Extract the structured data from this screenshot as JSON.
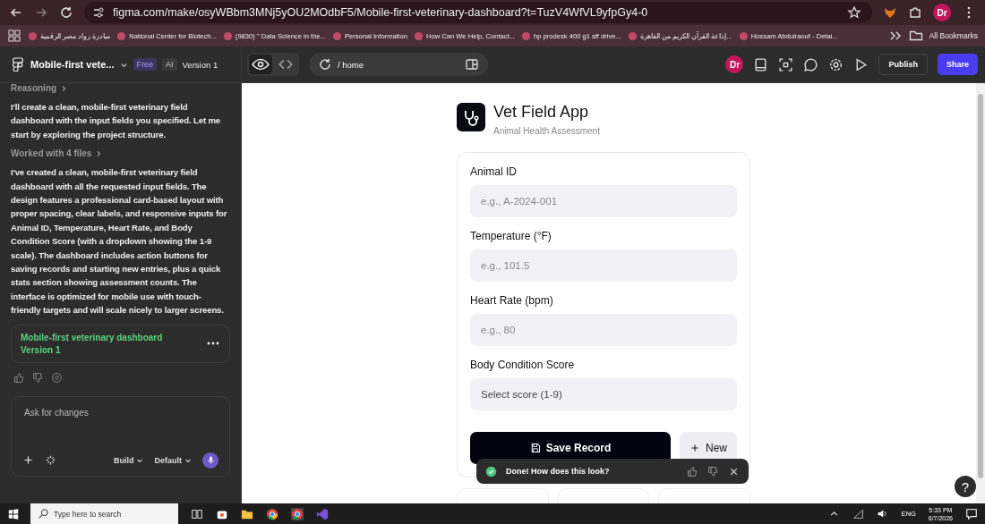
{
  "browser": {
    "url": "figma.com/make/osyWBbm3MNj5yOU2MOdbF5/Mobile-first-veterinary-dashboard?t=TuzV4WfVL9yfpGy4-0",
    "profile": "Dr",
    "bookmarks": [
      {
        "label": "مبادرة رواد مصر الرقمية"
      },
      {
        "label": "National Center for Biotech..."
      },
      {
        "label": "(9830) \" Data Science in the..."
      },
      {
        "label": "Personal Information"
      },
      {
        "label": "How Can We Help, Contact..."
      },
      {
        "label": "hp prodesk 400 g1 sff drive..."
      },
      {
        "label": "إذاعة القرآن الكريم من القاهرة..."
      },
      {
        "label": "Hossam Abdulraouf - Detai..."
      }
    ],
    "all_bookmarks": "All Bookmarks"
  },
  "header": {
    "project": "Mobile-first vete...",
    "plan": "Free",
    "ai": "AI",
    "version": "Version 1",
    "path": "/ home",
    "avatar": "Dr",
    "publish": "Publish",
    "share": "Share"
  },
  "chat": {
    "reasoning": "Reasoning",
    "intro": "I'll create a clean, mobile-first veterinary field dashboard with the input fields you specified. Let me start by exploring the project structure.",
    "worked": "Worked with 4 files",
    "summary": "I've created a clean, mobile-first veterinary field dashboard with all the requested input fields. The design features a professional card-based layout with proper spacing, clear labels, and responsive inputs for Animal ID, Temperature, Heart Rate, and Body Condition Score (with a dropdown showing the 1-9 scale). The dashboard includes action buttons for saving records and starting new entries, plus a quick stats section showing assessment counts. The interface is optimized for mobile use with touch-friendly targets and will scale nicely to larger screens.",
    "version_card": {
      "title": "Mobile-first veterinary dashboard",
      "version": "Version 1"
    },
    "input": {
      "placeholder": "Ask for changes"
    },
    "mode": "Build",
    "model": "Default"
  },
  "preview": {
    "title": "Vet Field App",
    "subtitle": "Animal Health Assessment",
    "fields": [
      {
        "label": "Animal ID",
        "placeholder": "e.g., A-2024-001",
        "kind": "text"
      },
      {
        "label": "Temperature (°F)",
        "placeholder": "e.g., 101.5",
        "kind": "text"
      },
      {
        "label": "Heart Rate (bpm)",
        "placeholder": "e.g., 80",
        "kind": "text"
      },
      {
        "label": "Body Condition Score",
        "placeholder": "Select score (1-9)",
        "kind": "select"
      }
    ],
    "save": "Save Record",
    "new": "New",
    "toast": "Done! How does this look?",
    "help": "?"
  },
  "taskbar": {
    "search": {
      "placeholder": "Type here to search"
    },
    "language": "ENG",
    "time": "5:33 PM",
    "date": "6/7/2026"
  }
}
